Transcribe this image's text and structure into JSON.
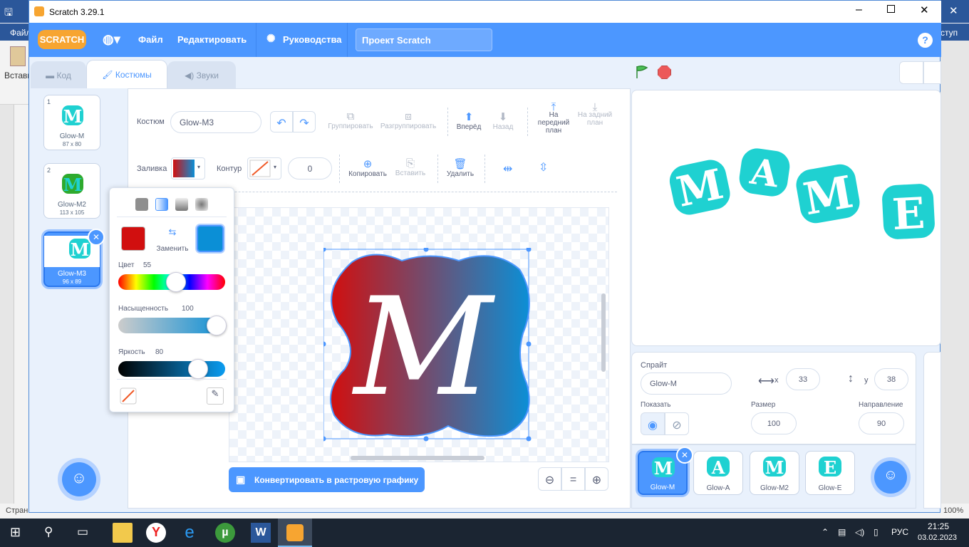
{
  "window": {
    "title": "Scratch 3.29.1"
  },
  "word_bg": {
    "menu_left": "Файл",
    "menu_right": "ступ",
    "ribbon_label": "Встави",
    "status_left": "Стран",
    "zoom": "100%"
  },
  "menubar": {
    "logo": "SCRATCH",
    "file": "Файл",
    "edit": "Редактировать",
    "tutorials": "Руководства",
    "project_title": "Проект Scratch",
    "help": "?"
  },
  "tabs": {
    "code": "Код",
    "costumes": "Костюмы",
    "sounds": "Звуки"
  },
  "costumes": [
    {
      "num": "1",
      "name": "Glow-M",
      "size": "87 x 80",
      "glyph": "M",
      "color": "#1fd1d1"
    },
    {
      "num": "2",
      "name": "Glow-M2",
      "size": "113 x 105",
      "glyph": "M",
      "color": "#2eaa2e"
    },
    {
      "num": "3",
      "name": "Glow-M3",
      "size": "96 x 89",
      "glyph": "M",
      "color": "#1fd1d1"
    }
  ],
  "editor": {
    "costume_label": "Костюм",
    "costume_name": "Glow-M3",
    "group": "Группировать",
    "ungroup": "Разгруппировать",
    "forward": "Вперёд",
    "backward": "Назад",
    "front": "На передний план",
    "back": "На задний план",
    "fill_label": "Заливка",
    "outline_label": "Контур",
    "outline_width": "0",
    "copy": "Копировать",
    "paste": "Вставить",
    "delete": "Удалить",
    "convert": "Конвертировать в растровую графику",
    "zoom_reset": "="
  },
  "color_popup": {
    "swap": "Заменить",
    "color_label": "Цвет",
    "color_value": "55",
    "saturation_label": "Насыщенность",
    "saturation_value": "100",
    "brightness_label": "Яркость",
    "brightness_value": "80",
    "color1": "#d10f0f",
    "color2": "#0b8fd6"
  },
  "stage": {
    "letters": [
      "M",
      "A",
      "M",
      "E"
    ],
    "letter_color": "#1fd1d1"
  },
  "sprite_info": {
    "sprite_label": "Спрайт",
    "sprite_name": "Glow-M",
    "x_label": "x",
    "x_value": "33",
    "y_label": "y",
    "y_value": "38",
    "show_label": "Показать",
    "size_label": "Размер",
    "size_value": "100",
    "direction_label": "Направление",
    "direction_value": "90"
  },
  "sprites": [
    {
      "name": "Glow-M",
      "glyph": "M"
    },
    {
      "name": "Glow-A",
      "glyph": "A"
    },
    {
      "name": "Glow-M2",
      "glyph": "M"
    },
    {
      "name": "Glow-E",
      "glyph": "E"
    }
  ],
  "taskbar": {
    "lang": "РУС",
    "time": "21:25",
    "date": "03.02.2023"
  }
}
